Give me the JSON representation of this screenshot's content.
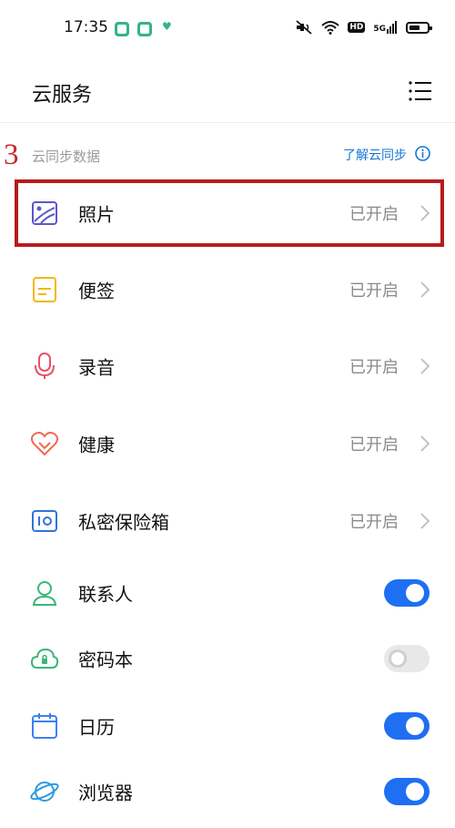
{
  "status_bar": {
    "time": "17:35",
    "network": "5G",
    "hd": "HD",
    "icons": [
      "app-icon",
      "app-icon",
      "heart-icon",
      "mute-icon",
      "wifi-icon",
      "hd-icon",
      "signal-icon",
      "battery-icon"
    ]
  },
  "header": {
    "title": "云服务",
    "menu_icon": "list-menu-icon"
  },
  "section": {
    "annotation": "3",
    "label": "云同步数据",
    "learn_link": "了解云同步",
    "info_icon": "info-icon"
  },
  "items": [
    {
      "label": "照片",
      "status": "已开启",
      "icon": "photo-icon",
      "color": "#5b57c9",
      "control": "chevron",
      "highlighted": true
    },
    {
      "label": "便签",
      "status": "已开启",
      "icon": "note-icon",
      "color": "#f2b705",
      "control": "chevron"
    },
    {
      "label": "录音",
      "status": "已开启",
      "icon": "microphone-icon",
      "color": "#e9506a",
      "control": "chevron"
    },
    {
      "label": "健康",
      "status": "已开启",
      "icon": "heart-icon",
      "color": "#f2674f",
      "control": "chevron"
    },
    {
      "label": "私密保险箱",
      "status": "已开启",
      "icon": "safe-icon",
      "color": "#2f74d8",
      "control": "chevron"
    },
    {
      "label": "联系人",
      "icon": "contact-icon",
      "color": "#39b77a",
      "control": "toggle",
      "enabled": true
    },
    {
      "label": "密码本",
      "icon": "cloud-lock-icon",
      "color": "#39b77a",
      "control": "toggle",
      "enabled": false
    },
    {
      "label": "日历",
      "icon": "calendar-icon",
      "color": "#3b82f0",
      "control": "toggle",
      "enabled": true
    },
    {
      "label": "浏览器",
      "icon": "browser-icon",
      "color": "#2f9be0",
      "control": "toggle",
      "enabled": true
    }
  ],
  "colors": {
    "accent": "#1e6ff2",
    "highlight_border": "#b71c1c",
    "link": "#1976d2"
  }
}
